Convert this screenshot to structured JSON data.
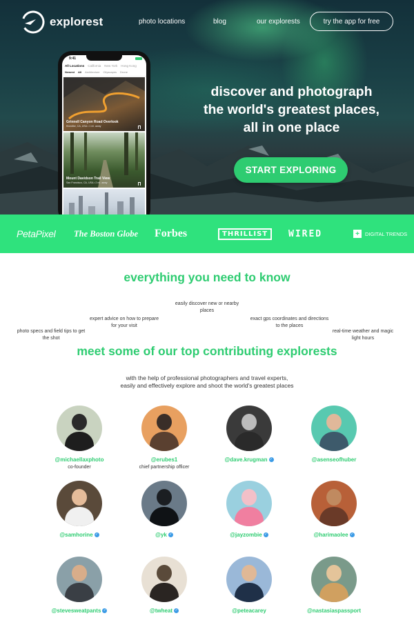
{
  "brand": {
    "name": "explorest"
  },
  "nav": {
    "items": [
      "photo locations",
      "blog",
      "our explorests"
    ],
    "cta": "try the app for free"
  },
  "hero": {
    "headline": [
      "discover and photograph",
      "the world's greatest places,",
      "all in one place"
    ],
    "cta": "START EXPLORING"
  },
  "phone": {
    "time": "9:41",
    "tabs": [
      "All Locations",
      "California",
      "New York",
      "Hong Kong"
    ],
    "filters": [
      "Newest",
      "All",
      "Architecture",
      "Cityscapes",
      "Drone"
    ],
    "cards": [
      {
        "title": "Grinnell Canyon Road Overlook",
        "sub": "Klondike, CA, USA • 1 mi. away"
      },
      {
        "title": "Mount Davidson Trail View",
        "sub": "San Francisco, CA, USA • 2 mi. away"
      }
    ]
  },
  "press": [
    "PetaPixel",
    "The Boston Globe",
    "Forbes",
    "THRILLIST",
    "WIRED",
    "DIGITAL TRENDS"
  ],
  "features": {
    "title": "everything you need to know",
    "items": [
      "photo specs and field tips to get the shot",
      "expert advice on how to prepare for your visit",
      "easily discover new or nearby places",
      "exact gps coordinates and directions to the places",
      "real-time weather and magic light hours"
    ]
  },
  "contributors": {
    "title": "meet some of our top contributing explorests",
    "subtitle": [
      "with the help of professional photographers and travel experts,",
      "easily and effectively explore and shoot the world's greatest places"
    ],
    "people": [
      {
        "handle": "@michaellaxphoto",
        "role": "co-founder",
        "verified": false
      },
      {
        "handle": "@erubes1",
        "role": "chief partnership officer",
        "verified": false
      },
      {
        "handle": "@dave.krugman",
        "role": "",
        "verified": true
      },
      {
        "handle": "@asenseofhuber",
        "role": "",
        "verified": false
      },
      {
        "handle": "@samhorine",
        "role": "",
        "verified": true
      },
      {
        "handle": "@yk",
        "role": "",
        "verified": true
      },
      {
        "handle": "@jayzombie",
        "role": "",
        "verified": true
      },
      {
        "handle": "@harimaolee",
        "role": "",
        "verified": true
      },
      {
        "handle": "@stevesweatpants",
        "role": "",
        "verified": true
      },
      {
        "handle": "@twheat",
        "role": "",
        "verified": true
      },
      {
        "handle": "@peteacarey",
        "role": "",
        "verified": false
      },
      {
        "handle": "@nastasiaspassport",
        "role": "",
        "verified": false
      }
    ]
  },
  "colors": {
    "accent": "#2ecc71",
    "press_bar": "#2fe27d",
    "verified": "#3c9be6"
  }
}
